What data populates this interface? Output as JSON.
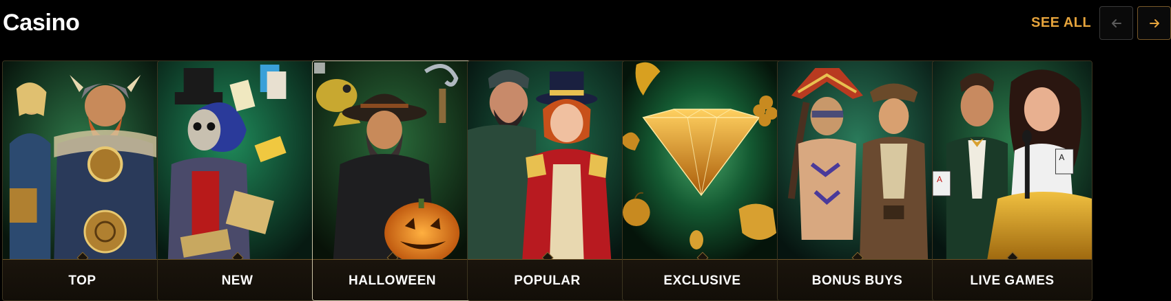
{
  "header": {
    "title": "Casino",
    "see_all_label": "SEE ALL",
    "prev_icon": "arrow-left-icon",
    "next_icon": "arrow-right-icon"
  },
  "colors": {
    "accent": "#e6a43c",
    "background": "#000000",
    "card_border": "#3d3520"
  },
  "cards": [
    {
      "label": "TOP",
      "art": "viking-warriors-art"
    },
    {
      "label": "NEW",
      "art": "voodoo-card-dealer-art"
    },
    {
      "label": "HALLOWEEN",
      "art": "pirate-pumpkin-art"
    },
    {
      "label": "POPULAR",
      "art": "explorers-circus-art"
    },
    {
      "label": "EXCLUSIVE",
      "art": "golden-diamond-art"
    },
    {
      "label": "BONUS BUYS",
      "art": "aztec-explorer-art"
    },
    {
      "label": "LIVE GAMES",
      "art": "live-dealers-art"
    }
  ]
}
